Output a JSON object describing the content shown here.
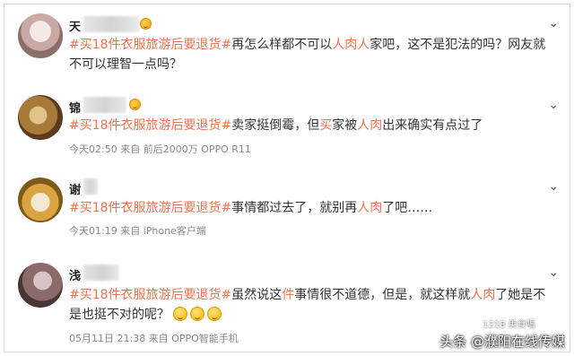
{
  "comments": [
    {
      "username": "天",
      "tag": "#买18件衣服旅游后要退货#",
      "segments": [
        "再怎么样都不可以",
        "人肉人",
        "家吧，这不是犯法的吗？网友就不可以理智一点吗？"
      ],
      "meta": ""
    },
    {
      "username": "锦",
      "tag": "#买18件衣服旅游后要退货#",
      "segments": [
        "卖家挺倒霉，但",
        "买",
        "家被",
        "人肉",
        "出来确实有点过了"
      ],
      "meta": "今天02:50 来自 前后2000万 OPPO R11"
    },
    {
      "username": "谢",
      "tag": "#买18件衣服旅游后要退货#",
      "segments": [
        "事情都过去了，就别再",
        "人肉",
        "了吧……"
      ],
      "meta": "今天01:19 来自 iPhone客户端"
    },
    {
      "username": "浅",
      "tag": "#买18件衣服旅游后要退货#",
      "segments": [
        "虽然说这",
        "件",
        "事情很不道德，但是，就这样就",
        "人肉",
        "了她是不是也挺不对的呢？"
      ],
      "meta": "05月11日 21:38 来自 OPPO智能手机"
    }
  ],
  "watermark": "头条 @濮阳在线传媒",
  "watermark_faint": "1218 美食唱",
  "icons": [
    "chevron-down-icon",
    "smiley-badge-icon",
    "emoji-icon"
  ],
  "colors": {
    "accent": "#eb7350",
    "text": "#333333",
    "meta": "#888888"
  }
}
